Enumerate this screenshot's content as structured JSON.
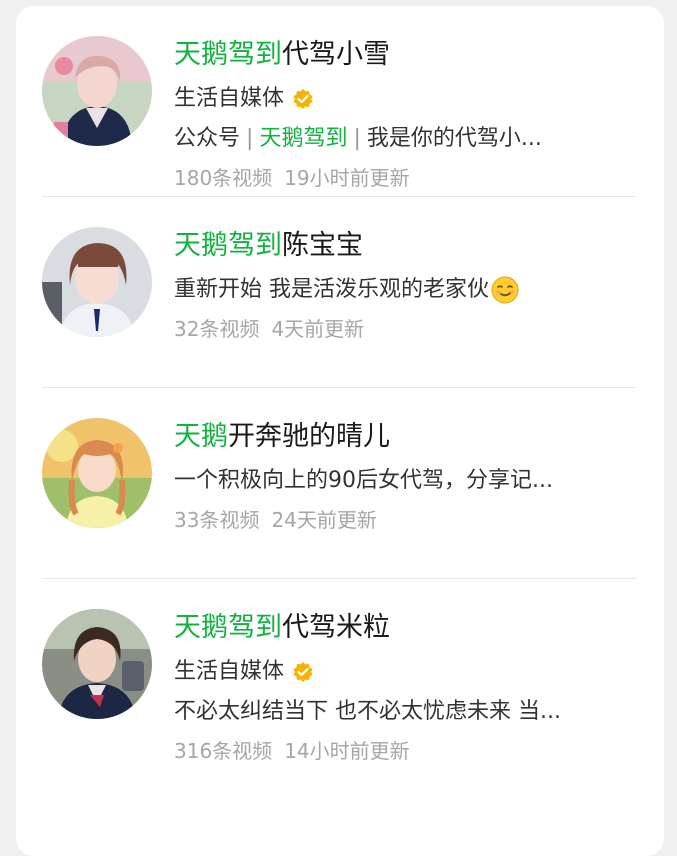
{
  "accounts": [
    {
      "name_highlight": "天鹅驾到",
      "name_rest": "代驾小雪",
      "line1": "生活自媒体",
      "verified": true,
      "line2_prefix": "公众号",
      "line2_green": "天鹅驾到",
      "line2_suffix": "我是你的代驾小...",
      "videos": "180条视频",
      "updated": "19小时前更新"
    },
    {
      "name_highlight": "天鹅驾到",
      "name_rest": "陈宝宝",
      "line1": "重新开始 我是活泼乐观的老家伙",
      "emoji": "smirk-emoji",
      "videos": "32条视频",
      "updated": "4天前更新"
    },
    {
      "name_highlight": "天鹅",
      "name_rest": "开奔驰的晴儿",
      "line1": "一个积极向上的90后女代驾，分享记...",
      "videos": "33条视频",
      "updated": "24天前更新"
    },
    {
      "name_highlight": "天鹅驾到",
      "name_rest": "代驾米粒",
      "line1": "生活自媒体",
      "verified": true,
      "line2": "不必太纠结当下 也不必太忧虑未来 当...",
      "videos": "316条视频",
      "updated": "14小时前更新"
    }
  ],
  "colors": {
    "highlight": "#12b23f",
    "verified_badge": "#f5b400",
    "meta_text": "#a6a6a6"
  }
}
